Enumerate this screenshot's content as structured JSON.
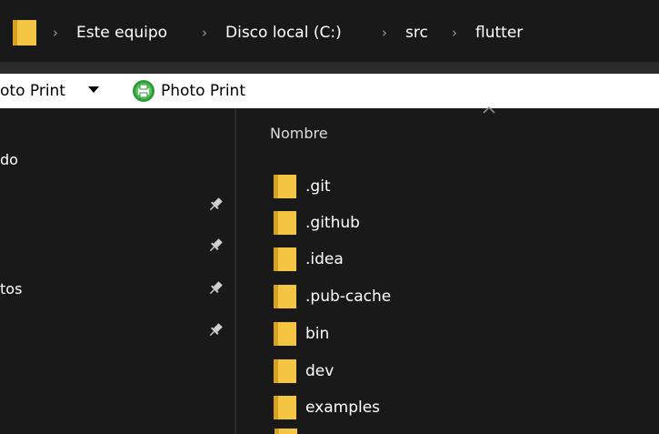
{
  "address": {
    "breadcrumbs": [
      "Este equipo",
      "Disco local (C:)",
      "src",
      "flutter"
    ],
    "separator": "›"
  },
  "toolbar": {
    "left_label": "oto Print",
    "right_label": "Photo Print"
  },
  "nav": {
    "items": [
      {
        "label": "do",
        "pinned": false
      },
      {
        "label": "",
        "pinned": true
      },
      {
        "label": "",
        "pinned": true
      },
      {
        "label": "tos",
        "pinned": true
      },
      {
        "label": "",
        "pinned": true
      }
    ]
  },
  "content": {
    "column_header": "Nombre",
    "files": [
      {
        "name": ".git",
        "icon": "folder-icon"
      },
      {
        "name": ".github",
        "icon": "folder-icon"
      },
      {
        "name": ".idea",
        "icon": "folder-icon"
      },
      {
        "name": ".pub-cache",
        "icon": "folder-icon"
      },
      {
        "name": "bin",
        "icon": "folder-icon"
      },
      {
        "name": "dev",
        "icon": "folder-icon"
      },
      {
        "name": "examples",
        "icon": "folder-icon"
      }
    ]
  },
  "colors": {
    "background": "#191919",
    "folder_yellow": "#f4c542",
    "folder_dark": "#d9a21e",
    "toolbar_bg": "#ffffff",
    "print_icon_green": "#2e9b3a"
  }
}
